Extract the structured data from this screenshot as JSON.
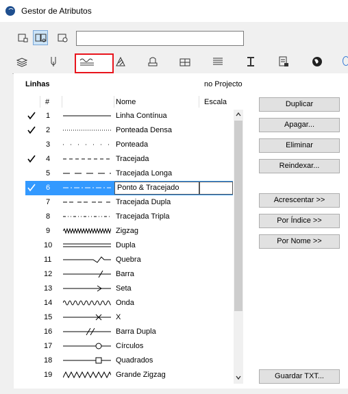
{
  "window": {
    "title": "Gestor de Atributos"
  },
  "search": {
    "value": ""
  },
  "tabs": [
    "layers-icon",
    "pen-icon",
    "line-type-icon",
    "fill-icon",
    "composite-icon",
    "building-material-icon",
    "profile-icon",
    "zone-icon",
    "operation-profile-icon",
    "surface-icon",
    "globe-icon"
  ],
  "list": {
    "section_label": "Linhas",
    "scope_label": "no Projecto",
    "headers": {
      "num": "#",
      "name": "Nome",
      "scale": "Escala"
    },
    "rows": [
      {
        "num": "1",
        "name": "Linha Contínua",
        "checked": true,
        "pattern": "solid"
      },
      {
        "num": "2",
        "name": "Ponteada Densa",
        "checked": true,
        "pattern": "dense-dot"
      },
      {
        "num": "3",
        "name": "Ponteada",
        "checked": false,
        "pattern": "dot"
      },
      {
        "num": "4",
        "name": "Tracejada",
        "checked": true,
        "pattern": "dash"
      },
      {
        "num": "5",
        "name": "Tracejada Longa",
        "checked": false,
        "pattern": "long-dash"
      },
      {
        "num": "6",
        "name": "Ponto & Tracejado",
        "checked": true,
        "pattern": "dash-dot",
        "selected": true
      },
      {
        "num": "7",
        "name": "Tracejada Dupla",
        "checked": false,
        "pattern": "dash-double"
      },
      {
        "num": "8",
        "name": "Tracejada Tripla",
        "checked": false,
        "pattern": "dash-triple"
      },
      {
        "num": "9",
        "name": "Zigzag",
        "checked": false,
        "pattern": "zigzag"
      },
      {
        "num": "10",
        "name": "Dupla",
        "checked": false,
        "pattern": "double"
      },
      {
        "num": "11",
        "name": "Quebra",
        "checked": false,
        "pattern": "break"
      },
      {
        "num": "12",
        "name": "Barra",
        "checked": false,
        "pattern": "bar"
      },
      {
        "num": "13",
        "name": "Seta",
        "checked": false,
        "pattern": "arrow"
      },
      {
        "num": "14",
        "name": "Onda",
        "checked": false,
        "pattern": "wave"
      },
      {
        "num": "15",
        "name": "X",
        "checked": false,
        "pattern": "x"
      },
      {
        "num": "16",
        "name": "Barra Dupla",
        "checked": false,
        "pattern": "double-bar"
      },
      {
        "num": "17",
        "name": "Círculos",
        "checked": false,
        "pattern": "circle"
      },
      {
        "num": "18",
        "name": "Quadrados",
        "checked": false,
        "pattern": "square"
      },
      {
        "num": "19",
        "name": "Grande Zigzag",
        "checked": false,
        "pattern": "big-zigzag"
      }
    ]
  },
  "buttons": {
    "duplicate": "Duplicar",
    "clear": "Apagar...",
    "delete": "Eliminar",
    "reindex": "Reindexar...",
    "append": "Acrescentar >>",
    "by_index": "Por Índice >>",
    "by_name": "Por Nome >>",
    "save_txt": "Guardar TXT..."
  },
  "colors": {
    "selection": "#3399ff",
    "highlight_box": "#e8141c"
  }
}
